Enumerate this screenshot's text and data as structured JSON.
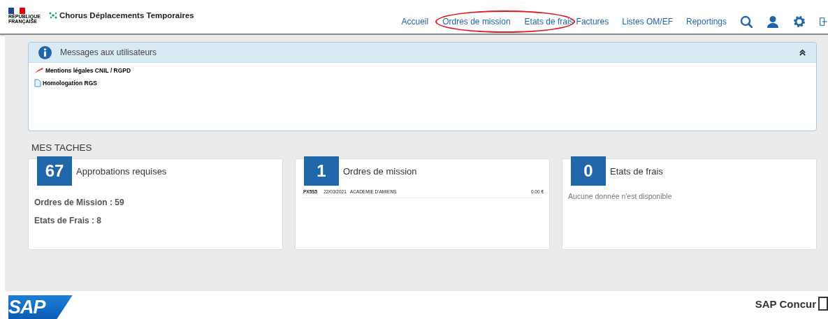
{
  "header": {
    "logo": {
      "lines": [
        "RÉPUBLIQUE",
        "FRANÇAISE"
      ]
    },
    "app_title": "Chorus Déplacements Temporaires",
    "nav": {
      "links_before": [
        "Accueil"
      ],
      "circled_links": [
        "Ordres de mission",
        "Etats de frais"
      ],
      "links_after": [
        "Factures",
        "Listes OM/EF",
        "Reportings"
      ]
    },
    "nav_icons": [
      {
        "kind": "search"
      },
      {
        "kind": "user"
      },
      {
        "kind": "settings"
      },
      {
        "kind": "logout"
      }
    ]
  },
  "messages": {
    "title": "Messages aux utilisateurs",
    "expanded": true,
    "items": [
      {
        "kind": "pin",
        "text": "Mentions légales CNIL / RGPD"
      },
      {
        "kind": "document",
        "text": "Homologation RGS"
      }
    ]
  },
  "tasks": {
    "title": "MES TACHES",
    "cards": [
      {
        "count": "67",
        "title": "Approbations requises",
        "lines": [
          "Ordres de Mission : 59",
          "Etats de Frais : 8"
        ]
      },
      {
        "count": "1",
        "title": "Ordres de mission",
        "rows": [
          {
            "id": "PX5S5",
            "date": "22/03/2021",
            "label": "ACADEMIE D'AMIENS",
            "amount": "0.00 €"
          }
        ]
      },
      {
        "count": "0",
        "title": "Etats de frais",
        "empty": "Aucune donnée n'est disponible"
      }
    ]
  },
  "footer": {
    "left_logo": "SAP",
    "right_brand": "SAP Concur"
  }
}
